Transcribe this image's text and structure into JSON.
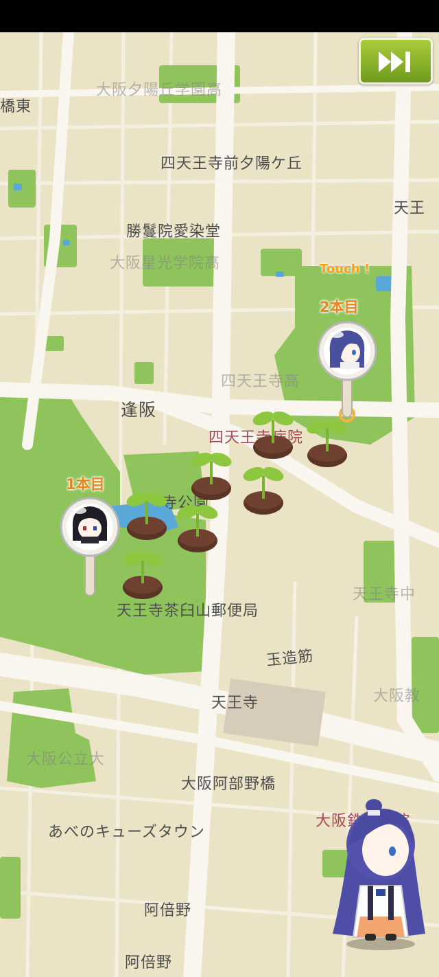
{
  "ui": {
    "skip_button_icon": "fast-forward-icon",
    "touch_hint": "Touch !"
  },
  "pins": [
    {
      "label": "1本目",
      "icon": "character-pin-dark-haired"
    },
    {
      "label": "2本目",
      "icon": "character-pin-blue-haired"
    }
  ],
  "map_labels": {
    "oosaka_yuhigaoka": "大阪夕陽丘学園高",
    "bridge_east": "橋東",
    "shitennoji_mae": "四天王寺前夕陽ケ丘",
    "tenno": "天王",
    "shomangin": "勝鬘院愛染堂",
    "oosaka_seiko": "大阪星光学院高",
    "shitennoji_high": "四天王寺高",
    "ousaka": "逢阪",
    "shitennoji_hospital": "四天王寺病院",
    "park": "寺公園",
    "chausuyama_post": "天王寺茶臼山郵便局",
    "tennoji_junior": "天王寺中",
    "tamatsukuri": "玉造筋",
    "tennoji": "天王寺",
    "oosaka_kyo": "大阪教",
    "oosaka_public_univ": "大阪公立大",
    "abenobashi": "大阪阿部野橋",
    "hospital_br": "大阪鉄道病院",
    "abeno_cues": "あべのキューズタウン",
    "abeno_1": "阿倍野",
    "abeno_2": "阿倍野"
  },
  "colors": {
    "map_bg": "#ece4c7",
    "road": "#f7f4ea",
    "park": "#8fc45c",
    "water": "#5aa8d8",
    "accent": "#e8861b",
    "button": "#8cb62c"
  }
}
